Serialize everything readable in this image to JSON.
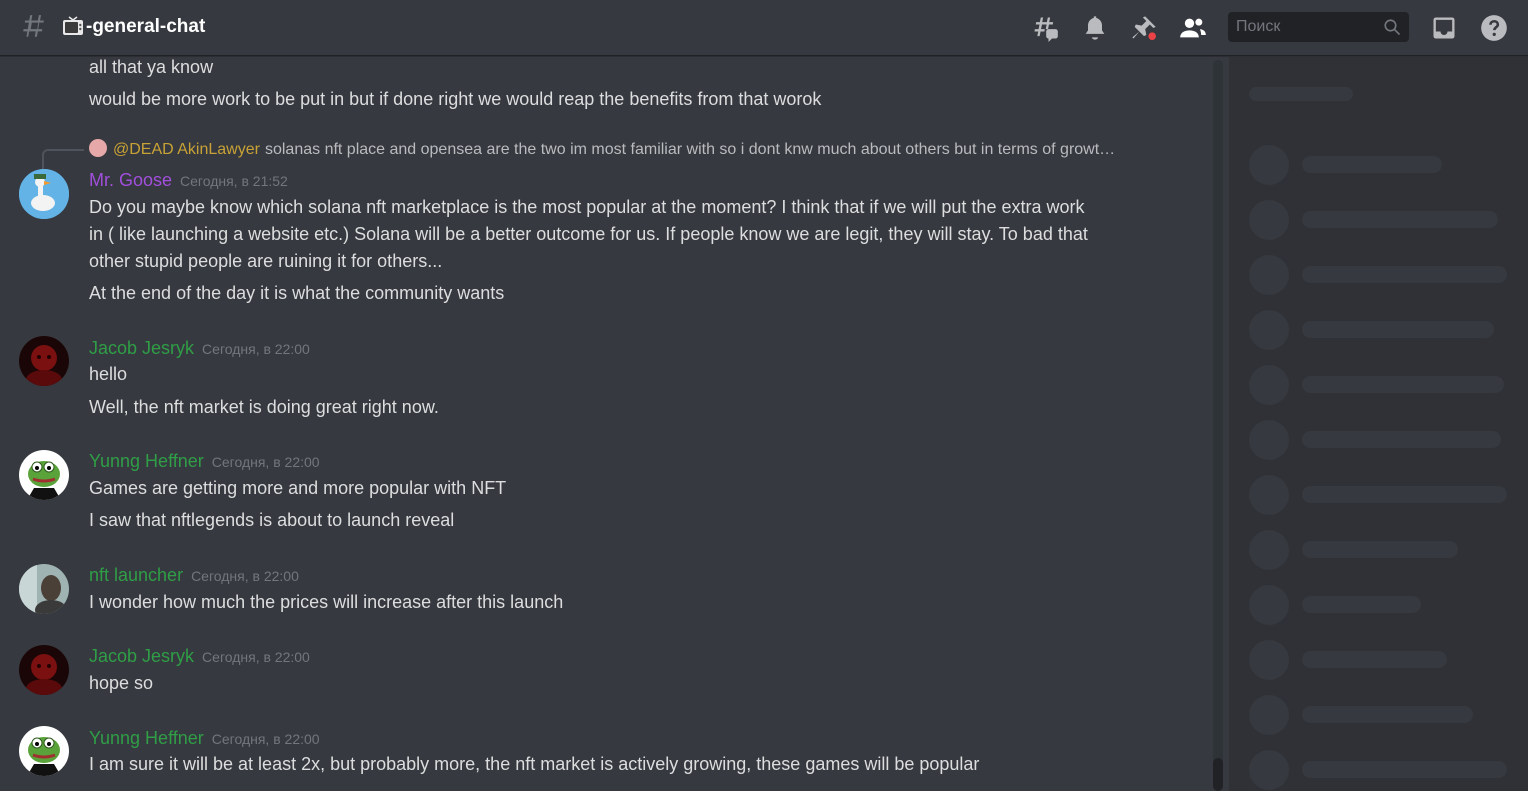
{
  "header": {
    "channel_name": "-general-chat",
    "search_placeholder": "Поиск",
    "icons": [
      "threads-icon",
      "bell-icon",
      "pin-icon",
      "members-icon",
      "search-icon",
      "inbox-icon",
      "help-icon"
    ]
  },
  "colors": {
    "background": "#36393f",
    "sidebar": "#2f3136",
    "mr_goose": "#a14fdc",
    "green_name": "#2f9e46",
    "mention": "#c8a236"
  },
  "messages": {
    "cont_1": "all that ya know",
    "cont_2": "would be more work to be put in but if done right we would reap the benefits from that worok",
    "reply": {
      "mention": "@DEAD AkinLawyer",
      "text": "solanas nft place and opensea  are the two im most familiar with so i dont knw much about others but in terms of growt…"
    },
    "goose": {
      "author": "Mr. Goose",
      "time": "Сегодня, в 21:52",
      "line1": "Do you maybe know which solana nft marketplace is the most popular at the moment? I think that if we will put the extra work",
      "line2": "in ( like launching a website etc.) Solana will be a better outcome for us. If people know we are legit, they will stay. To bad that",
      "line3": "other stupid people are ruining it for others...",
      "line4": "At the end of the day it is what the community wants"
    },
    "jacob1": {
      "author": "Jacob Jesryk",
      "time": "Сегодня, в 22:00",
      "line1": "hello",
      "line2": "Well, the nft market is doing great right now."
    },
    "yunng1": {
      "author": "Yunng Heffner",
      "time": "Сегодня, в 22:00",
      "line1": "Games are getting more and more popular with NFT",
      "line2": "I saw that nftlegends is about to launch reveal"
    },
    "launcher": {
      "author": "nft launcher",
      "time": "Сегодня, в 22:00",
      "line1": "I wonder how much the prices will increase after this launch"
    },
    "jacob2": {
      "author": "Jacob Jesryk",
      "time": "Сегодня, в 22:00",
      "line1": "hope so"
    },
    "yunng2": {
      "author": "Yunng Heffner",
      "time": "Сегодня, в 22:00",
      "line1": "I am sure it will be at least 2x, but probably more, the nft market is actively growing, these games will be popular"
    }
  }
}
